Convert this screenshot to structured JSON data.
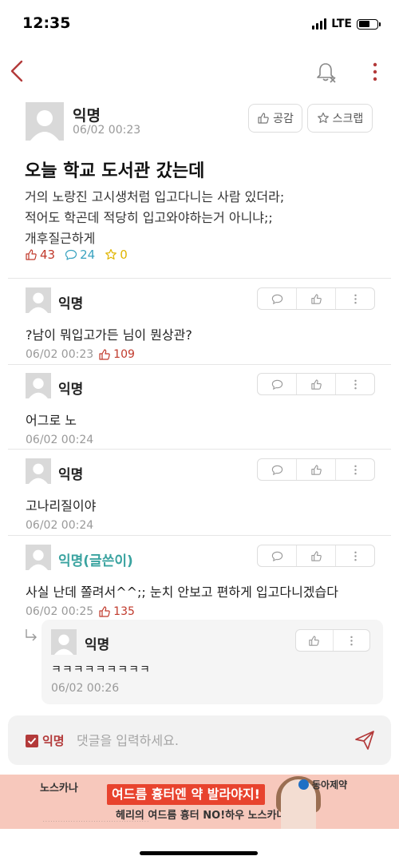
{
  "status": {
    "time": "12:35",
    "network": "LTE"
  },
  "post": {
    "author": "익명",
    "date": "06/02 00:23",
    "like_button": "공감",
    "scrap_button": "스크랩",
    "title": "오늘 학교 도서관 갔는데",
    "body_lines": [
      "거의 노랑진 고시생처럼 입고다니는 사람 있더라;",
      "적어도 학곤데 적당히 입고와야하는거 아니냐;;",
      "개후질근하게"
    ],
    "stats": {
      "likes": "43",
      "comments": "24",
      "scraps": "0"
    }
  },
  "comments": [
    {
      "author": "익명",
      "text": "?남이 뭐입고가든 님이 뭔상관?",
      "date": "06/02 00:23",
      "likes": "109"
    },
    {
      "author": "익명",
      "text": "어그로 노",
      "date": "06/02 00:24",
      "likes": ""
    },
    {
      "author": "익명",
      "text": "고나리질이야",
      "date": "06/02 00:24",
      "likes": ""
    },
    {
      "author": "익명(글쓴이)",
      "text": "사실 난데 쫄려서^^;; 눈치 안보고 편하게 입고다니겠습다",
      "date": "06/02 00:25",
      "likes": "135"
    }
  ],
  "reply": {
    "author": "익명",
    "text": "ㅋㅋㅋㅋㅋㅋㅋㅋㅋ",
    "date": "06/02 00:26"
  },
  "input": {
    "anonymous_label": "익명",
    "placeholder": "댓글을 입력하세요."
  },
  "ad": {
    "brand": "노스카나",
    "headline": "여드름 흉터엔 약 발라야지!",
    "subline": "헤리의 여드름 흉터 NO!하우 노스카나",
    "sponsor": "동아제약"
  },
  "colors": {
    "accent": "#b33a3a",
    "teal": "#3aa3a0",
    "like_red": "#c0392b",
    "ad_bg": "#f7c8bc"
  }
}
